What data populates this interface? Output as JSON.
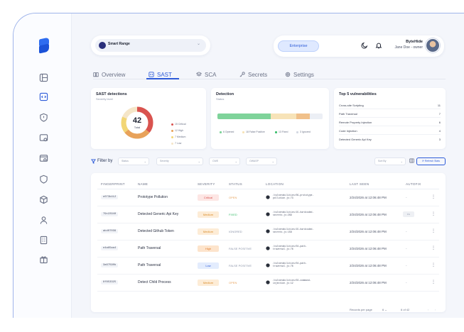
{
  "colors": {
    "accent": "#2d5bd8",
    "critical": "#d9534f",
    "high": "#e8a25a",
    "medium": "#f2c94c",
    "low": "#f5e6c8",
    "fixed": "#3fbf6f"
  },
  "header": {
    "project": "Smart Range",
    "plan_badge": "Enterprise",
    "user_company": "ByteHide",
    "user_role": "Jane Doe - owner"
  },
  "tabs": [
    {
      "label": "Overview",
      "icon": "book-icon"
    },
    {
      "label": "SAST",
      "icon": "code-window-icon"
    },
    {
      "label": "SCA",
      "icon": "layers-icon"
    },
    {
      "label": "Secrets",
      "icon": "key-icon"
    },
    {
      "label": "Settings",
      "icon": "gear-icon"
    }
  ],
  "sast_card": {
    "title": "SAST detections",
    "subtitle": "Severity level",
    "total": "42",
    "total_label": "Total",
    "legend": [
      "15 Critical",
      "12 High",
      "7 Medium",
      "7 Low"
    ]
  },
  "detection_card": {
    "title": "Detection",
    "subtitle": "Status",
    "legend": [
      "6 Opened",
      "18 False Positive",
      "13 Fixed",
      "3 Ignored"
    ]
  },
  "top5_card": {
    "title": "Top 5 vulnerabilities",
    "items": [
      {
        "name": "Cross-site Scripting",
        "count": "11"
      },
      {
        "name": "Path Traversal",
        "count": "7"
      },
      {
        "name": "Remote Property Injection",
        "count": "6"
      },
      {
        "name": "Code Injection",
        "count": "4"
      },
      {
        "name": "Detected Generic Api Key",
        "count": "3"
      }
    ]
  },
  "filters": {
    "label": "Filter by",
    "selects": [
      "Status",
      "Severity",
      "CWE",
      "OWASP"
    ],
    "sort": "Sort By",
    "refresh": "Refresh Stats"
  },
  "table": {
    "headers": [
      "FINGERPRINT",
      "NAME",
      "SEVERITY",
      "STATUS",
      "LOCATION",
      "LAST SEEN",
      "AUTOFIX"
    ],
    "rows": [
      {
        "fp": "e073b412",
        "name": "Prototype Pollution",
        "severity": "Critical",
        "status": "OPEN",
        "loc1": "/vulnerabilities/09-prototype-",
        "loc2": "pollution.js:73",
        "seen": "2/24/2026 at 12:06:48 PM",
        "autofix": "-"
      },
      {
        "fp": "79c22940",
        "name": "Detected Generic Api Key",
        "severity": "Medium",
        "status": "FIXED",
        "loc1": "/vulnerabilities/15-hardcoded-",
        "loc2": "secrets.js:269",
        "seen": "2/24/2026 at 12:06:48 PM",
        "autofix": "Fix"
      },
      {
        "fp": "abd07039",
        "name": "Detected Github Token",
        "severity": "Medium",
        "status": "IGNORED",
        "loc1": "/vulnerabilities/15-hardcoded-",
        "loc2": "secrets.js:158",
        "seen": "2/24/2026 at 12:06:48 PM",
        "autofix": "-"
      },
      {
        "fp": "e4a65aa4",
        "name": "Path Traversal",
        "severity": "High",
        "status": "FALSE POSITIVE",
        "loc1": "/vulnerabilities/04-path-",
        "loc2": "traversal.js:76",
        "seen": "2/24/2026 at 12:06:48 PM",
        "autofix": "-"
      },
      {
        "fp": "3a67590b",
        "name": "Path Traversal",
        "severity": "Low",
        "status": "FALSE POSITIVE",
        "loc1": "/vulnerabilities/04-path-",
        "loc2": "traversal.js:76",
        "seen": "2/24/2026 at 12:06:48 PM",
        "autofix": "-"
      },
      {
        "fp": "8f853325",
        "name": "Detect Child Process",
        "severity": "Medium",
        "status": "OPEN",
        "loc1": "/vulnerabilities/03-command-",
        "loc2": "injection.js:12",
        "seen": "2/24/2026 at 12:06:48 PM",
        "autofix": "-"
      }
    ],
    "pagination": {
      "rows_label": "Records per page",
      "rows_value": "6",
      "range": "6",
      "of": "of 42"
    }
  }
}
